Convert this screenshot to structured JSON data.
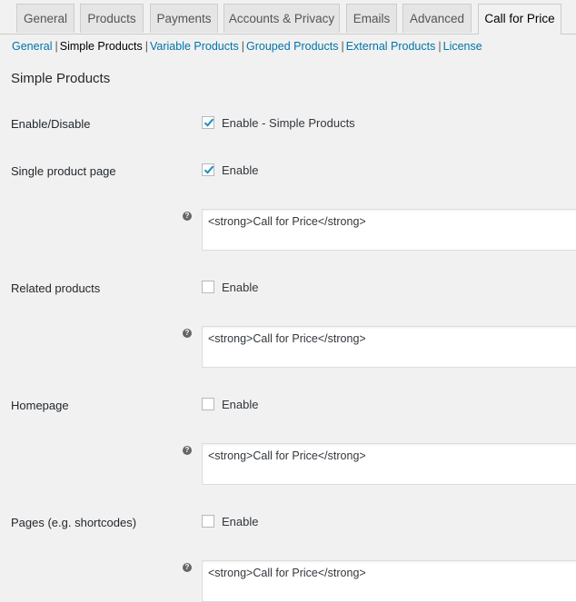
{
  "tabs": [
    {
      "label": "General",
      "active": false
    },
    {
      "label": "Products",
      "active": false
    },
    {
      "label": "Payments",
      "active": false
    },
    {
      "label": "Accounts & Privacy",
      "active": false
    },
    {
      "label": "Emails",
      "active": false
    },
    {
      "label": "Advanced",
      "active": false
    },
    {
      "label": "Call for Price",
      "active": true
    }
  ],
  "subnav": {
    "items": [
      {
        "label": "General",
        "current": false
      },
      {
        "label": "Simple Products",
        "current": true
      },
      {
        "label": "Variable Products",
        "current": false
      },
      {
        "label": "Grouped Products",
        "current": false
      },
      {
        "label": "External Products",
        "current": false
      },
      {
        "label": "License",
        "current": false
      }
    ],
    "separator": "|"
  },
  "section_title": "Simple Products",
  "settings": [
    {
      "label": "Enable/Disable",
      "checkbox_label": "Enable - Simple Products",
      "checked": true
    },
    {
      "label": "Single product page",
      "checkbox_label": "Enable",
      "checked": true,
      "text_value": "<strong>Call for Price</strong>"
    },
    {
      "label": "Related products",
      "checkbox_label": "Enable",
      "checked": false,
      "text_value": "<strong>Call for Price</strong>"
    },
    {
      "label": "Homepage",
      "checkbox_label": "Enable",
      "checked": false,
      "text_value": "<strong>Call for Price</strong>"
    },
    {
      "label": "Pages (e.g. shortcodes)",
      "checkbox_label": "Enable",
      "checked": false,
      "text_value": "<strong>Call for Price</strong>"
    }
  ],
  "help_icon_glyph": "?",
  "colors": {
    "link": "#0073aa",
    "check": "#1e8cbe"
  }
}
